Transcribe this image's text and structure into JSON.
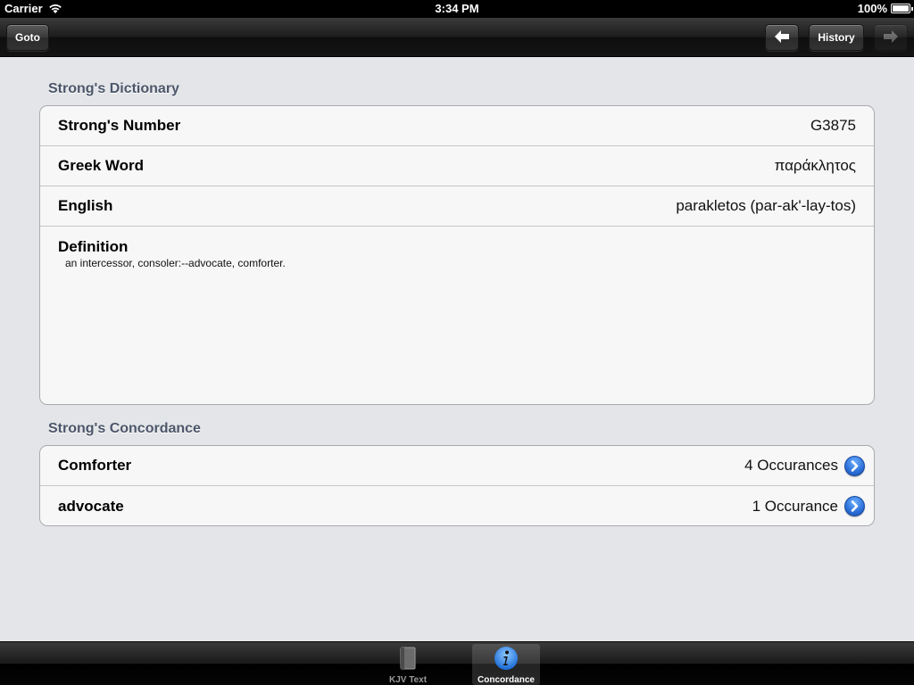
{
  "status_bar": {
    "carrier": "Carrier",
    "time": "3:34 PM",
    "battery": "100%"
  },
  "nav_bar": {
    "goto_label": "Goto",
    "history_label": "History",
    "back_icon": "back-arrow-icon",
    "forward_icon": "forward-arrow-icon"
  },
  "dictionary": {
    "section_title": "Strong's Dictionary",
    "strongs_number": {
      "label": "Strong's Number",
      "value": "G3875"
    },
    "greek_word": {
      "label": "Greek Word",
      "value": "παράκλητος"
    },
    "english": {
      "label": "English",
      "value": "parakletos (par-ak'-lay-tos)"
    },
    "definition": {
      "label": "Definition",
      "value": "an intercessor, consoler:--advocate, comforter."
    }
  },
  "concordance": {
    "section_title": "Strong's Concordance",
    "rows": [
      {
        "word": "Comforter",
        "count": "4 Occurances"
      },
      {
        "word": "advocate",
        "count": "1 Occurance"
      }
    ]
  },
  "tab_bar": {
    "tabs": [
      {
        "label": "KJV Text",
        "icon": "book-icon",
        "active": false
      },
      {
        "label": "Concordance",
        "icon": "info-icon",
        "active": true
      }
    ]
  },
  "colors": {
    "background": "#e3e5e8",
    "section_title": "#4c566a",
    "disclosure_blue": "#2a6fd6"
  }
}
